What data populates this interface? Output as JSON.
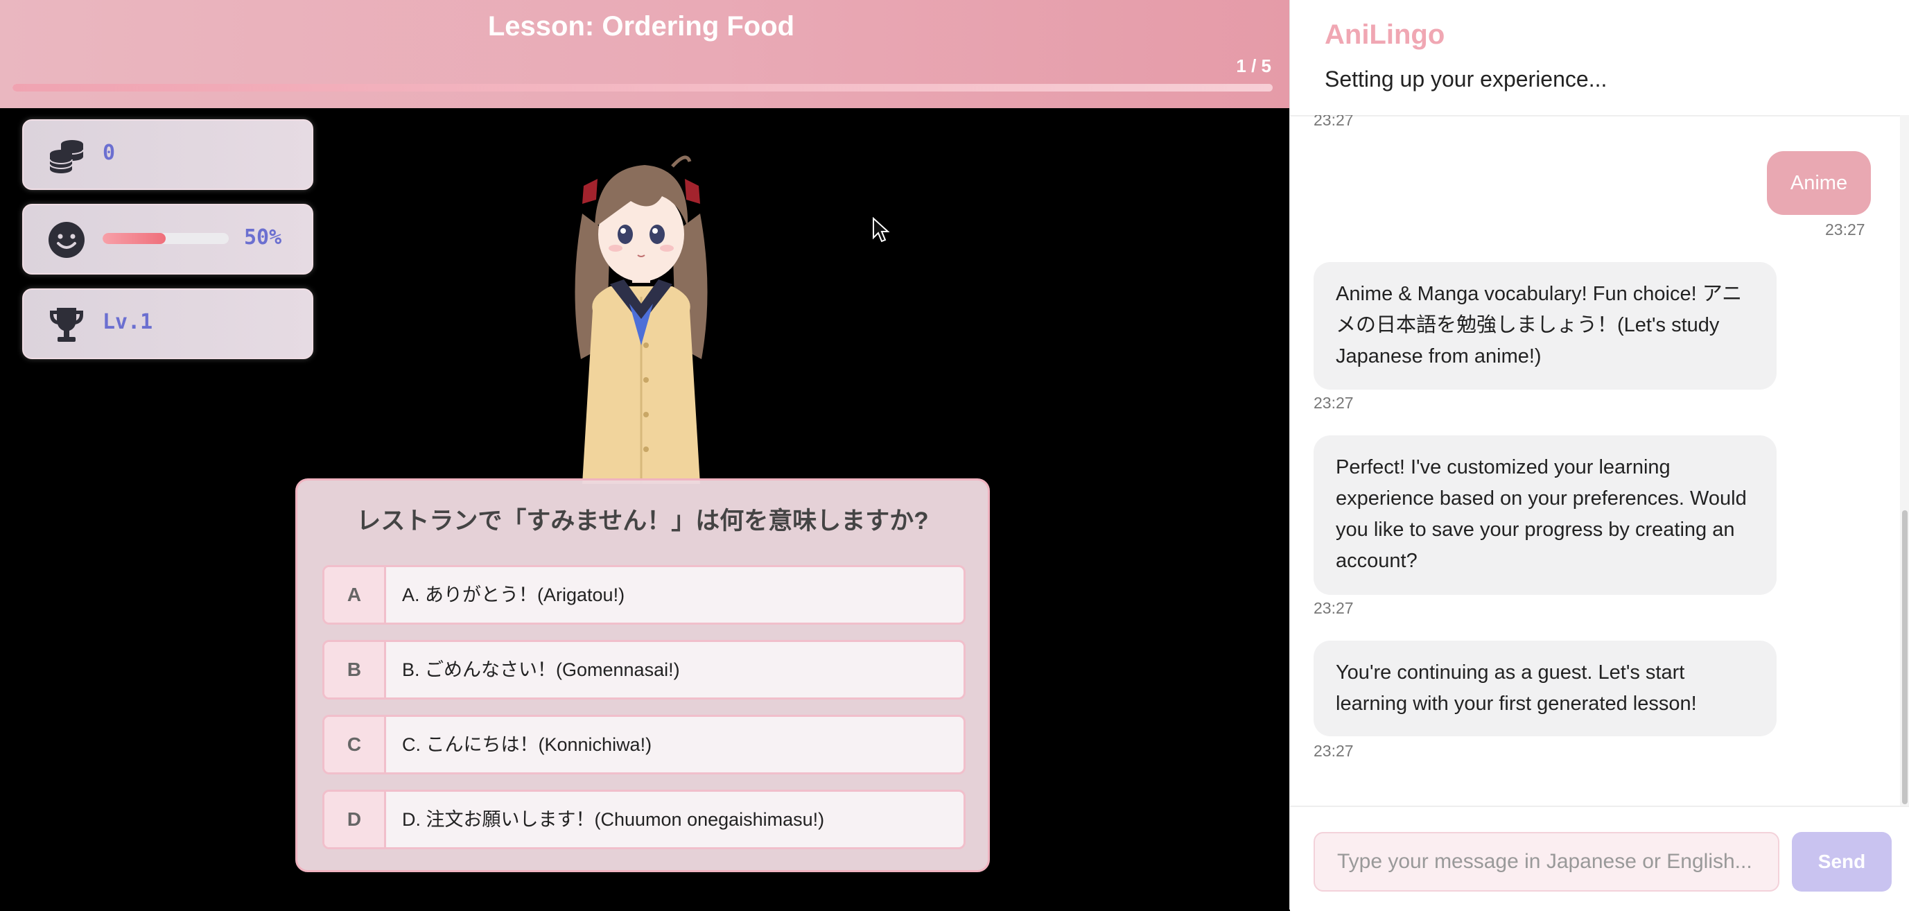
{
  "lesson": {
    "title": "Lesson: Ordering Food",
    "progress_text": "1 / 5",
    "progress_fraction": 1.0
  },
  "stats": {
    "coins": "0",
    "mood_percent_text": "50%",
    "mood_fraction": 0.5,
    "level": "Lv.1",
    "icons": [
      "coins-icon",
      "smiley-icon",
      "trophy-icon"
    ]
  },
  "quiz": {
    "question": "レストランで「すみません！」は何を意味しますか?",
    "options": [
      {
        "letter": "A",
        "text": "A. ありがとう！(Arigatou!)"
      },
      {
        "letter": "B",
        "text": "B. ごめんなさい！(Gomennasai!)"
      },
      {
        "letter": "C",
        "text": "C. こんにちは！(Konnichiwa!)"
      },
      {
        "letter": "D",
        "text": "D. 注文お願いします！(Chuumon onegaishimasu!)"
      }
    ]
  },
  "chat": {
    "app_name": "AniLingo",
    "status": "Setting up your experience...",
    "messages": [
      {
        "from": "bot",
        "text": "",
        "time": "23:27"
      },
      {
        "from": "user",
        "text": "Anime",
        "time": "23:27"
      },
      {
        "from": "bot",
        "text": "Anime & Manga vocabulary! Fun choice! アニメの日本語を勉強しましょう！(Let's study Japanese from anime!)",
        "time": "23:27"
      },
      {
        "from": "bot",
        "text": "Perfect! I've customized your learning experience based on your preferences. Would you like to save your progress by creating an account?",
        "time": "23:27"
      },
      {
        "from": "bot",
        "text": "You're continuing as a guest. Let's start learning with your first generated lesson!",
        "time": "23:27"
      }
    ],
    "input_placeholder": "Type your message in Japanese or English...",
    "send_label": "Send"
  },
  "colors": {
    "header_pink": "#e9aab6",
    "accent_pink": "#f0a7b3",
    "user_bubble": "#e9a8b2",
    "send_button": "#c9c3f0",
    "stat_value": "#6b6fd0"
  }
}
